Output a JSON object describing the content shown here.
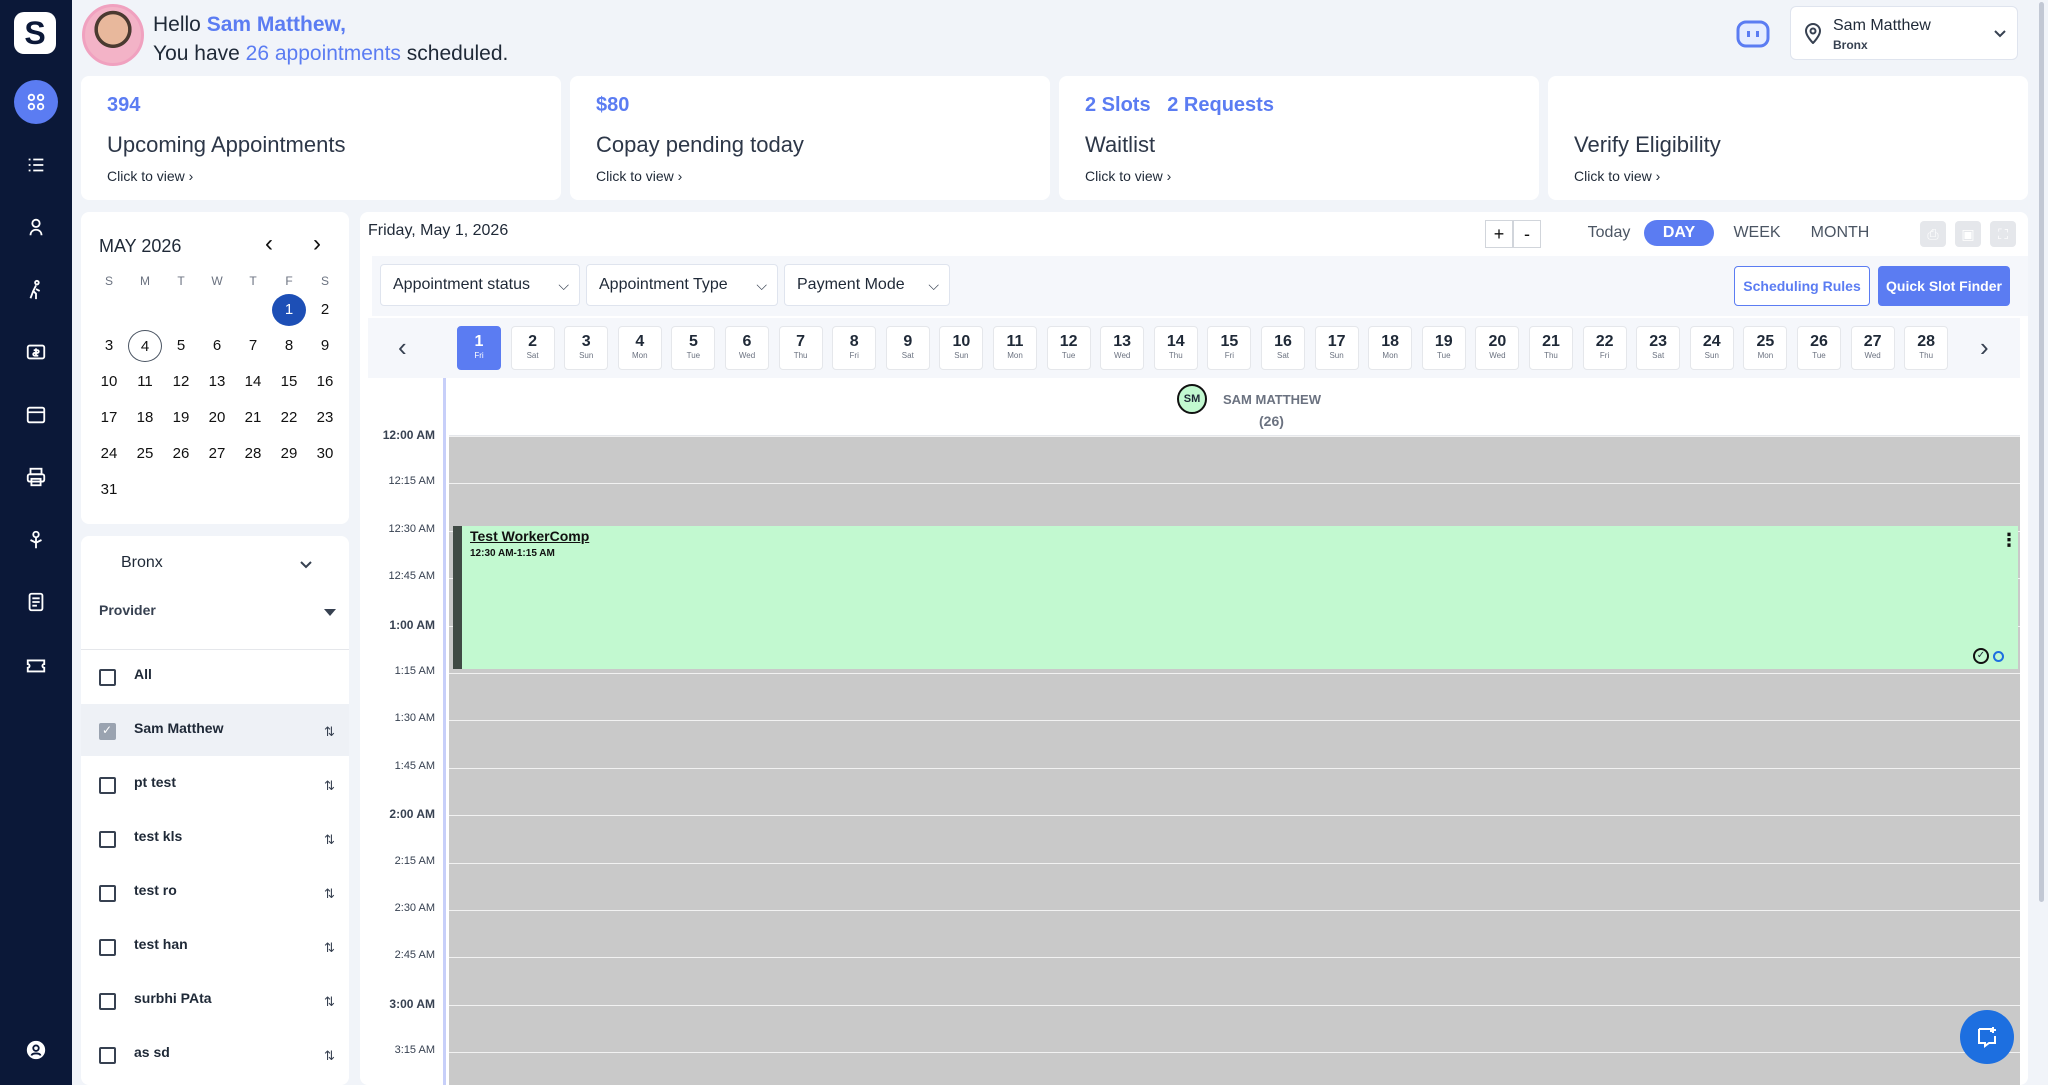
{
  "app": {
    "logo_letter": "S"
  },
  "sidebar": {
    "items": [
      "dashboard-icon",
      "list-icon",
      "provider-icon",
      "walk-icon",
      "billing-icon",
      "archive-icon",
      "print-icon",
      "reports-icon",
      "document-icon",
      "ticket-icon"
    ],
    "bottom": "account-icon"
  },
  "header": {
    "hello": "Hello",
    "user_name": "Sam Matthew,",
    "you_have": "You have",
    "appt_count": "26 appointments",
    "scheduled": "scheduled.",
    "location_user": "Sam Matthew",
    "location_name": "Bronx"
  },
  "cards": [
    {
      "num": "394",
      "title": "Upcoming Appointments",
      "link": "Click to view"
    },
    {
      "num": "$80",
      "title": "Copay pending today",
      "link": "Click to view"
    },
    {
      "num": "2 Slots   2 Requests",
      "title": "Waitlist",
      "link": "Click to view"
    },
    {
      "num": "",
      "title": "Verify Eligibility",
      "link": "Click to view"
    }
  ],
  "mini_calendar": {
    "month": "MAY 2026",
    "dow": [
      "S",
      "M",
      "T",
      "W",
      "T",
      "F",
      "S"
    ],
    "weeks": [
      [
        "",
        "",
        "",
        "",
        "",
        "1",
        "2"
      ],
      [
        "3",
        "4",
        "5",
        "6",
        "7",
        "8",
        "9"
      ],
      [
        "10",
        "11",
        "12",
        "13",
        "14",
        "15",
        "16"
      ],
      [
        "17",
        "18",
        "19",
        "20",
        "21",
        "22",
        "23"
      ],
      [
        "24",
        "25",
        "26",
        "27",
        "28",
        "29",
        "30"
      ],
      [
        "31",
        "",
        "",
        "",
        "",
        "",
        ""
      ]
    ],
    "selected": "1",
    "today": "4"
  },
  "providers_panel": {
    "location": "Bronx",
    "provider_label": "Provider",
    "rows": [
      {
        "label": "All",
        "checked": false,
        "sort": false
      },
      {
        "label": "Sam Matthew",
        "checked": true,
        "sort": true
      },
      {
        "label": "pt test",
        "checked": false,
        "sort": true
      },
      {
        "label": "test kls",
        "checked": false,
        "sort": true
      },
      {
        "label": "test ro",
        "checked": false,
        "sort": true
      },
      {
        "label": "test han",
        "checked": false,
        "sort": true
      },
      {
        "label": "surbhi PAta",
        "checked": false,
        "sort": true
      },
      {
        "label": "as sd",
        "checked": false,
        "sort": true
      }
    ]
  },
  "scheduler": {
    "date_title": "Friday, May 1, 2026",
    "zoom_in": "+",
    "zoom_out": "-",
    "tabs": [
      "Today",
      "DAY",
      "WEEK",
      "MONTH"
    ],
    "active_tab": "DAY",
    "filters": [
      "Appointment status",
      "Appointment Type",
      "Payment Mode"
    ],
    "scheduling_rules": "Scheduling Rules",
    "quick_slot_finder": "Quick Slot Finder",
    "days": [
      {
        "n": "1",
        "w": "Fri"
      },
      {
        "n": "2",
        "w": "Sat"
      },
      {
        "n": "3",
        "w": "Sun"
      },
      {
        "n": "4",
        "w": "Mon"
      },
      {
        "n": "5",
        "w": "Tue"
      },
      {
        "n": "6",
        "w": "Wed"
      },
      {
        "n": "7",
        "w": "Thu"
      },
      {
        "n": "8",
        "w": "Fri"
      },
      {
        "n": "9",
        "w": "Sat"
      },
      {
        "n": "10",
        "w": "Sun"
      },
      {
        "n": "11",
        "w": "Mon"
      },
      {
        "n": "12",
        "w": "Tue"
      },
      {
        "n": "13",
        "w": "Wed"
      },
      {
        "n": "14",
        "w": "Thu"
      },
      {
        "n": "15",
        "w": "Fri"
      },
      {
        "n": "16",
        "w": "Sat"
      },
      {
        "n": "17",
        "w": "Sun"
      },
      {
        "n": "18",
        "w": "Mon"
      },
      {
        "n": "19",
        "w": "Tue"
      },
      {
        "n": "20",
        "w": "Wed"
      },
      {
        "n": "21",
        "w": "Thu"
      },
      {
        "n": "22",
        "w": "Fri"
      },
      {
        "n": "23",
        "w": "Sat"
      },
      {
        "n": "24",
        "w": "Sun"
      },
      {
        "n": "25",
        "w": "Mon"
      },
      {
        "n": "26",
        "w": "Tue"
      },
      {
        "n": "27",
        "w": "Wed"
      },
      {
        "n": "28",
        "w": "Thu"
      }
    ],
    "provider_initials": "SM",
    "provider_name": "SAM MATTHEW",
    "provider_count": "(26)",
    "times": [
      {
        "t": "12:00 AM",
        "b": true
      },
      {
        "t": "12:15 AM",
        "b": false
      },
      {
        "t": "12:30 AM",
        "b": false
      },
      {
        "t": "12:45 AM",
        "b": false
      },
      {
        "t": "1:00 AM",
        "b": true
      },
      {
        "t": "1:15 AM",
        "b": false
      },
      {
        "t": "1:30 AM",
        "b": false
      },
      {
        "t": "1:45 AM",
        "b": false
      },
      {
        "t": "2:00 AM",
        "b": true
      },
      {
        "t": "2:15 AM",
        "b": false
      },
      {
        "t": "2:30 AM",
        "b": false
      },
      {
        "t": "2:45 AM",
        "b": false
      },
      {
        "t": "3:00 AM",
        "b": true
      },
      {
        "t": "3:15 AM",
        "b": false
      }
    ],
    "appointment": {
      "title": "Test WorkerComp",
      "time": "12:30 AM-1:15 AM"
    }
  },
  "colors": {
    "accent": "#5b7cf2",
    "sidebar": "#0b1838",
    "appointment": "#c2f9d0"
  }
}
